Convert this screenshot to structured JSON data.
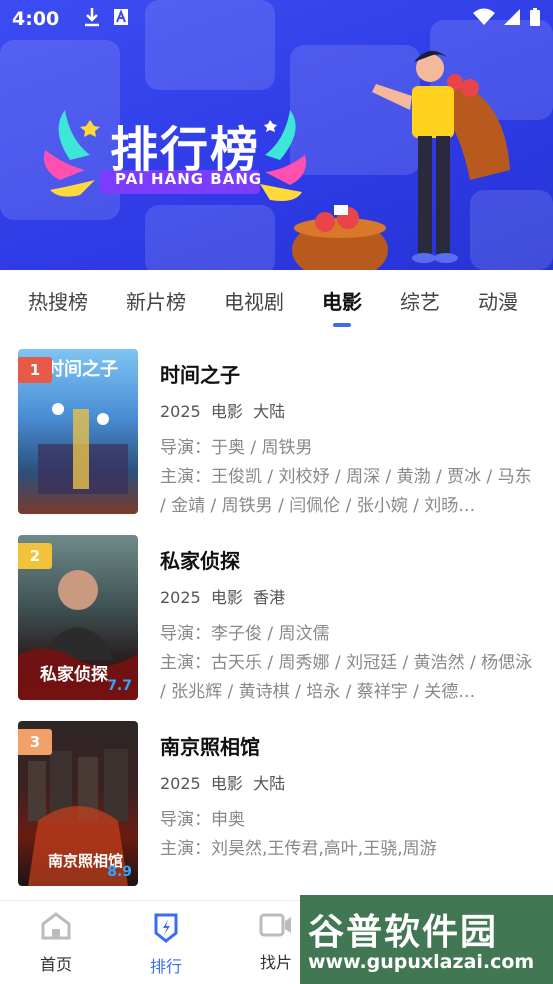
{
  "status_bar": {
    "time": "4:00"
  },
  "banner": {
    "title": "排行榜",
    "subtitle": "PAI HANG BANG"
  },
  "tabs": [
    {
      "label": "热搜榜",
      "active": false
    },
    {
      "label": "新片榜",
      "active": false
    },
    {
      "label": "电视剧",
      "active": false
    },
    {
      "label": "电影",
      "active": true
    },
    {
      "label": "综艺",
      "active": false
    },
    {
      "label": "动漫",
      "active": false
    }
  ],
  "movies": [
    {
      "rank": "1",
      "rank_color": "#e85a48",
      "title": "时间之子",
      "year": "2025",
      "type": "电影",
      "region": "大陆",
      "director": "导演：于奥 / 周铁男",
      "cast": "主演：王俊凯 / 刘校妤 / 周深 / 黄渤 / 贾冰 / 马东 / 金靖 / 周铁男 / 闫佩伦 / 张小婉 / 刘旸…",
      "poster_text": "时间之子",
      "score": ""
    },
    {
      "rank": "2",
      "rank_color": "#f2c23a",
      "title": "私家侦探",
      "year": "2025",
      "type": "电影",
      "region": "香港",
      "director": "导演：李子俊 / 周汶儒",
      "cast": "主演：古天乐 / 周秀娜 / 刘冠廷 / 黄浩然 / 杨偲泳 / 张兆辉 / 黄诗棋 / 培永 / 蔡祥宇 / 关德…",
      "poster_text": "私家侦探",
      "score": "7.7"
    },
    {
      "rank": "3",
      "rank_color": "#f2a06a",
      "title": "南京照相馆",
      "year": "2025",
      "type": "电影",
      "region": "大陆",
      "director": "导演：申奥",
      "cast": "主演：刘昊然,王传君,高叶,王骁,周游",
      "poster_text": "南京照相馆",
      "score": "8.9"
    }
  ],
  "bottom_nav": [
    {
      "label": "首页",
      "icon": "home-icon",
      "active": false
    },
    {
      "label": "排行",
      "icon": "ranking-icon",
      "active": true
    },
    {
      "label": "找片",
      "icon": "video-icon",
      "active": false
    }
  ],
  "watermark": {
    "big": "谷普软件园",
    "small": "www.gupuxlazai.com"
  }
}
